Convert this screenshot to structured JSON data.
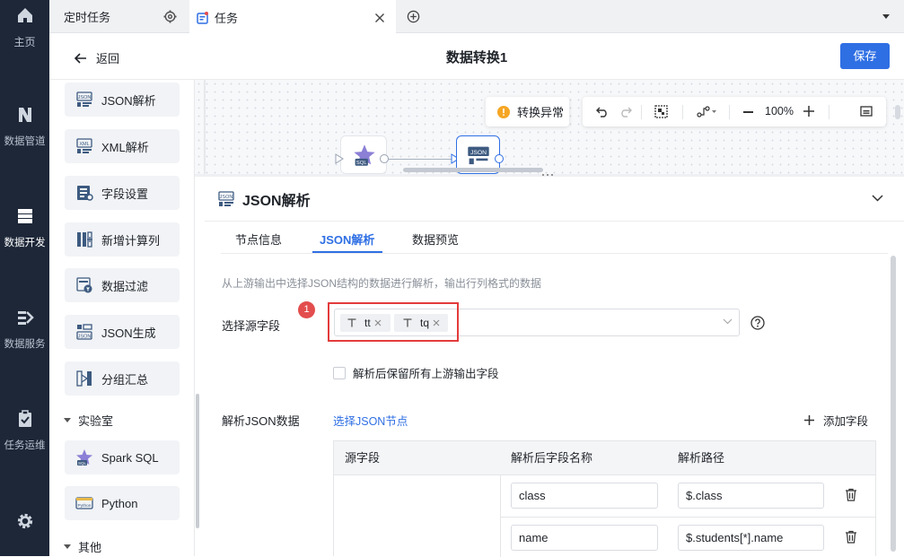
{
  "leftnav": {
    "items": [
      {
        "label": "主页",
        "icon": "home-icon"
      },
      {
        "label": "数据管道",
        "icon": "pipeline-icon"
      },
      {
        "label": "数据开发",
        "icon": "dev-icon"
      },
      {
        "label": "数据服务",
        "icon": "service-icon"
      },
      {
        "label": "任务运维",
        "icon": "ops-icon"
      }
    ],
    "settings_icon": "gear-icon"
  },
  "tabs": [
    {
      "label": "定时任务"
    },
    {
      "label": "任务"
    }
  ],
  "header": {
    "back_label": "返回",
    "title": "数据转换1",
    "save_label": "保存"
  },
  "sidebar": {
    "items": [
      {
        "label": "JSON解析"
      },
      {
        "label": "XML解析"
      },
      {
        "label": "字段设置"
      },
      {
        "label": "新增计算列"
      },
      {
        "label": "数据过滤"
      },
      {
        "label": "JSON生成"
      },
      {
        "label": "分组汇总"
      }
    ],
    "section_lab": "实验室",
    "lab_items": [
      {
        "label": "Spark SQL"
      },
      {
        "label": "Python"
      }
    ],
    "section_other": "其他"
  },
  "canvas": {
    "warning_label": "转换异常",
    "zoom": "100%",
    "node_sql": "SQL",
    "node_json": "JSON"
  },
  "panel": {
    "title": "JSON解析",
    "tabs": [
      {
        "label": "节点信息"
      },
      {
        "label": "JSON解析"
      },
      {
        "label": "数据预览"
      }
    ],
    "active_tab": 1,
    "description": "从上游输出中选择JSON结构的数据进行解析，输出行列格式的数据",
    "source_label": "选择源字段",
    "marker": "1",
    "tags": [
      {
        "label": "tt"
      },
      {
        "label": "tq"
      }
    ],
    "checkbox_label": "解析后保留所有上游输出字段",
    "json_label": "解析JSON数据",
    "select_node_link": "选择JSON节点",
    "add_field_label": "添加字段",
    "table": {
      "headers": [
        "源字段",
        "解析后字段名称",
        "解析路径"
      ],
      "rows": [
        {
          "name": "class",
          "path": "$.class"
        },
        {
          "name": "name",
          "path": "$.students[*].name"
        }
      ]
    }
  },
  "colors": {
    "accent": "#2f6fe4",
    "nav_bg": "#1d2738",
    "danger": "#e34d4d",
    "warning": "#f5a623"
  }
}
